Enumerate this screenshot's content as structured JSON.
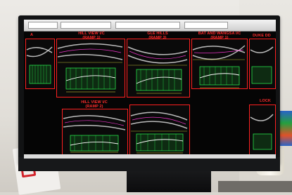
{
  "drawing_labels": {
    "top_left": "A",
    "hill_view_1_line1": "HILL VIEW I/C",
    "hill_view_1_line2": "(RAMP 1)",
    "ramp3_line1": "GLE HILLS",
    "ramp3_line2": "(RAMP 3)",
    "bat_line1": "BAT AND WANGSA I/C",
    "bat_line2": "(RAMP 1)",
    "duke": "DUKE DD",
    "hill_view_2_line1": "HILL VIEW I/C",
    "hill_view_2_line2": "(RAMP 2)",
    "lock": "LOCK"
  },
  "colors": {
    "label_red": "#ff2d2d",
    "cad_green": "#27e04a",
    "cad_yellow": "#e8e43a",
    "cad_magenta": "#ff39d8",
    "background": "#050505"
  }
}
